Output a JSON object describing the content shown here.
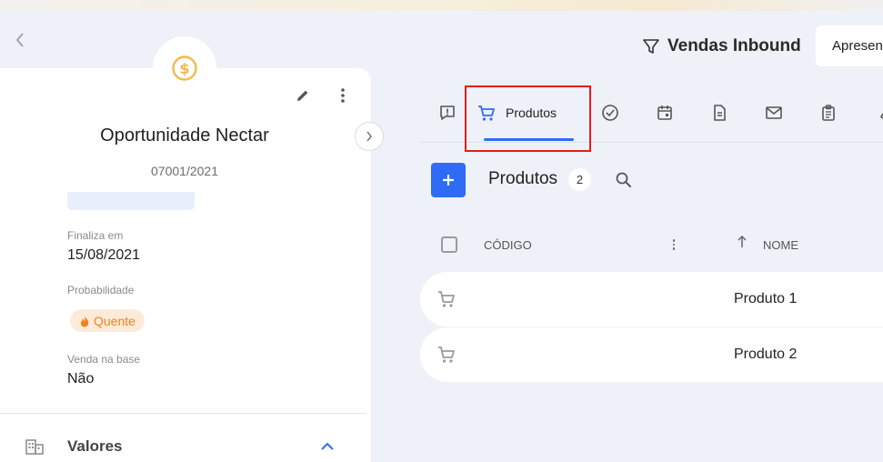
{
  "opportunity": {
    "title": "Oportunidade Nectar",
    "code": "07001/2021",
    "fields": [
      {
        "label": "Finaliza em",
        "value": "15/08/2021"
      },
      {
        "label": "Probabilidade",
        "badge": "Quente"
      },
      {
        "label": "Venda na base",
        "value": "Não"
      }
    ],
    "section": "Valores"
  },
  "header": {
    "pipeline": "Vendas Inbound",
    "present_button": "Apresentar"
  },
  "tabs": {
    "active_label": "Produtos",
    "icons": [
      "alert-square-icon",
      "cart-icon",
      "check-circle-icon",
      "calendar-icon",
      "document-icon",
      "mail-icon",
      "clipboard-icon",
      "attachment-icon"
    ]
  },
  "products": {
    "title": "Produtos",
    "count": "2",
    "columns": [
      "CÓDIGO",
      "NOME"
    ],
    "rows": [
      {
        "code": "",
        "name": "Produto 1"
      },
      {
        "code": "",
        "name": "Produto 2"
      }
    ]
  },
  "colors": {
    "accent": "#2e6cf6",
    "hot": "#f2811d",
    "highlight": "#e51c1c",
    "coin": "#f5b84a"
  }
}
